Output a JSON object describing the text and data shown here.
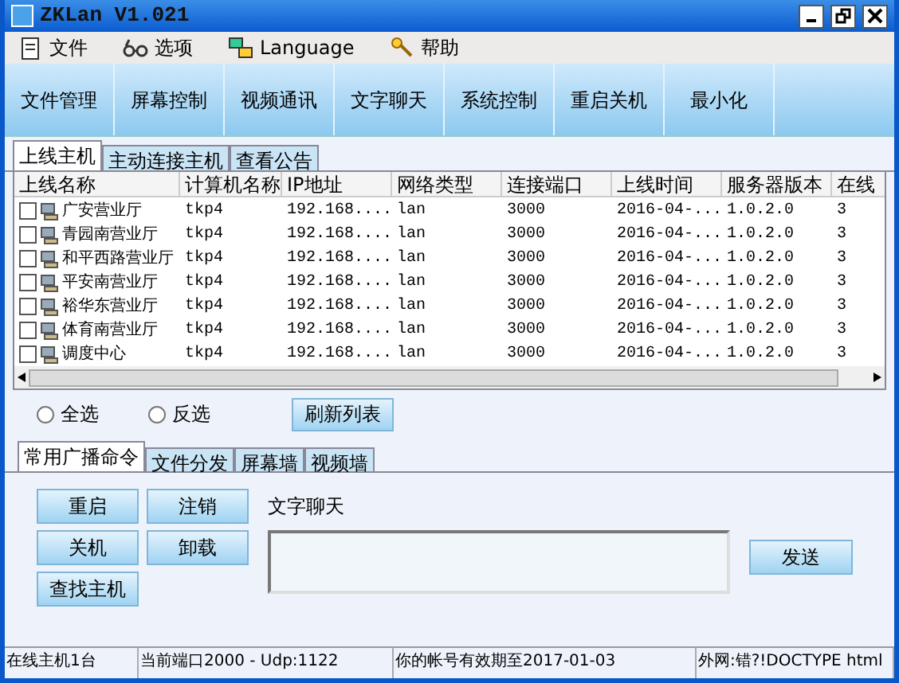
{
  "window": {
    "title": "ZKLan V1.021"
  },
  "menu": [
    "文件",
    "选项",
    "Language",
    "帮助"
  ],
  "toolbar": [
    "文件管理",
    "屏幕控制",
    "视频通讯",
    "文字聊天",
    "系统控制",
    "重启关机",
    "最小化"
  ],
  "tabs": [
    {
      "label": "上线主机",
      "selected": true
    },
    {
      "label": "主动连接主机",
      "selected": false
    },
    {
      "label": "查看公告",
      "selected": false
    }
  ],
  "table": {
    "columns": [
      "上线名称",
      "计算机名称",
      "IP地址",
      "网络类型",
      "连接端口",
      "上线时间",
      "服务器版本",
      "在线"
    ],
    "rows": [
      {
        "checked": false,
        "cells": [
          "广安营业厅",
          "tkp4",
          "192.168....",
          "lan",
          "3000",
          "2016-04-...",
          "1.0.2.0",
          "3"
        ]
      },
      {
        "checked": false,
        "cells": [
          "青园南营业厅",
          "tkp4",
          "192.168....",
          "lan",
          "3000",
          "2016-04-...",
          "1.0.2.0",
          "3"
        ]
      },
      {
        "checked": false,
        "cells": [
          "和平西路营业厅",
          "tkp4",
          "192.168....",
          "lan",
          "3000",
          "2016-04-...",
          "1.0.2.0",
          "3"
        ]
      },
      {
        "checked": false,
        "cells": [
          "平安南营业厅",
          "tkp4",
          "192.168....",
          "lan",
          "3000",
          "2016-04-...",
          "1.0.2.0",
          "3"
        ]
      },
      {
        "checked": false,
        "cells": [
          "裕华东营业厅",
          "tkp4",
          "192.168....",
          "lan",
          "3000",
          "2016-04-...",
          "1.0.2.0",
          "3"
        ]
      },
      {
        "checked": false,
        "cells": [
          "体育南营业厅",
          "tkp4",
          "192.168....",
          "lan",
          "3000",
          "2016-04-...",
          "1.0.2.0",
          "3"
        ]
      },
      {
        "checked": false,
        "cells": [
          "调度中心",
          "tkp4",
          "192.168....",
          "lan",
          "3000",
          "2016-04-...",
          "1.0.2.0",
          "3"
        ]
      }
    ]
  },
  "selection": [
    {
      "label": "全选",
      "selected": false
    },
    {
      "label": "反选",
      "selected": false
    }
  ],
  "refresh_button": "刷新列表",
  "subtabs": [
    {
      "label": "常用广播命令",
      "selected": true
    },
    {
      "label": "文件分发",
      "selected": false
    },
    {
      "label": "屏幕墙",
      "selected": false
    },
    {
      "label": "视频墙",
      "selected": false
    }
  ],
  "commands": [
    "重启",
    "注销",
    "关机",
    "卸载",
    "查找主机"
  ],
  "chat": {
    "label": "文字聊天",
    "send": "发送"
  },
  "status_bar": [
    "在线主机1台",
    "当前端口2000 - Udp:1122",
    "你的帐号有效期至2017-01-03",
    "外网:错?!DOCTYPE html"
  ]
}
